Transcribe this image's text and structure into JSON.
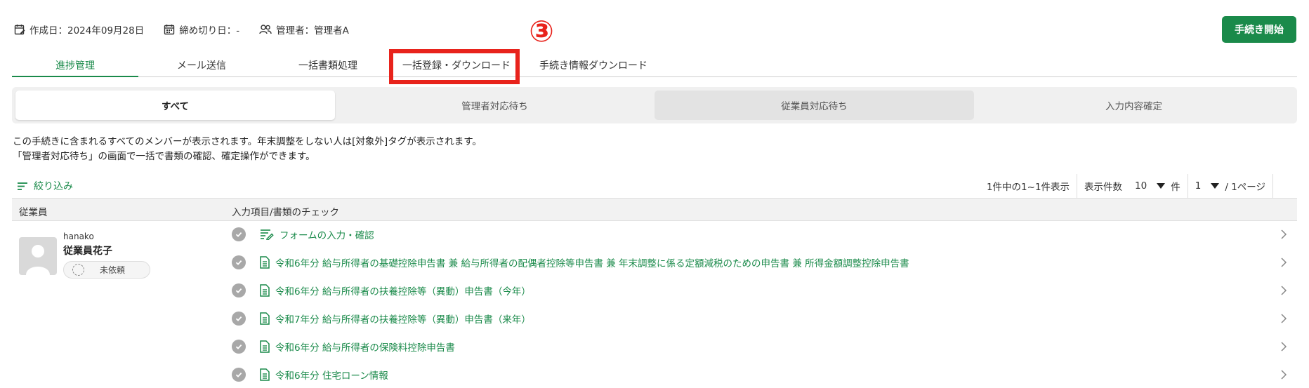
{
  "meta": {
    "created": "作成日：2024年09月28日",
    "deadline": "締め切り日：-",
    "manager": "管理者：管理者A"
  },
  "start_button": "手続き開始",
  "annotation": {
    "number": "③",
    "color": "#e8231c"
  },
  "tabs": [
    {
      "label": "進捗管理",
      "active": true
    },
    {
      "label": "メール送信",
      "active": false
    },
    {
      "label": "一括書類処理",
      "active": false
    },
    {
      "label": "一括登録・ダウンロード",
      "active": false
    },
    {
      "label": "手続き情報ダウンロード",
      "active": false
    }
  ],
  "segments": [
    {
      "label": "すべて",
      "state": "active"
    },
    {
      "label": "管理者対応待ち",
      "state": "normal"
    },
    {
      "label": "従業員対応待ち",
      "state": "hover"
    },
    {
      "label": "入力内容確定",
      "state": "normal"
    }
  ],
  "description": [
    "この手続きに含まれるすべてのメンバーが表示されます。年末調整をしない人は[対象外]タグが表示されます。",
    "「管理者対応待ち」の画面で一括で書類の確認、確定操作ができます。"
  ],
  "filter_label": "絞り込み",
  "pager": {
    "summary": "1件中の1~1件表示",
    "per_page_label": "表示件数",
    "per_page_value": "10",
    "per_page_unit": "件",
    "page_value": "1",
    "page_total": "/ 1ページ"
  },
  "table": {
    "col_employee": "従業員",
    "col_items": "入力項目/書類のチェック"
  },
  "employee": {
    "id": "hanako",
    "name": "従業員花子",
    "status": "未依頼"
  },
  "items": [
    {
      "label": "フォームの入力・確認",
      "icon": "form-edit-icon"
    },
    {
      "label": "令和6年分 給与所得者の基礎控除申告書 兼 給与所得者の配偶者控除等申告書 兼 年末調整に係る定額減税のための申告書 兼 所得金額調整控除申告書",
      "icon": "document-icon"
    },
    {
      "label": "令和6年分 給与所得者の扶養控除等（異動）申告書（今年）",
      "icon": "document-icon"
    },
    {
      "label": "令和7年分 給与所得者の扶養控除等（異動）申告書（来年）",
      "icon": "document-icon"
    },
    {
      "label": "令和6年分 給与所得者の保険料控除申告書",
      "icon": "document-icon"
    },
    {
      "label": "令和6年分 住宅ローン情報",
      "icon": "document-icon"
    }
  ],
  "colors": {
    "accent": "#1a8a4a",
    "annotation": "#e8231c"
  }
}
